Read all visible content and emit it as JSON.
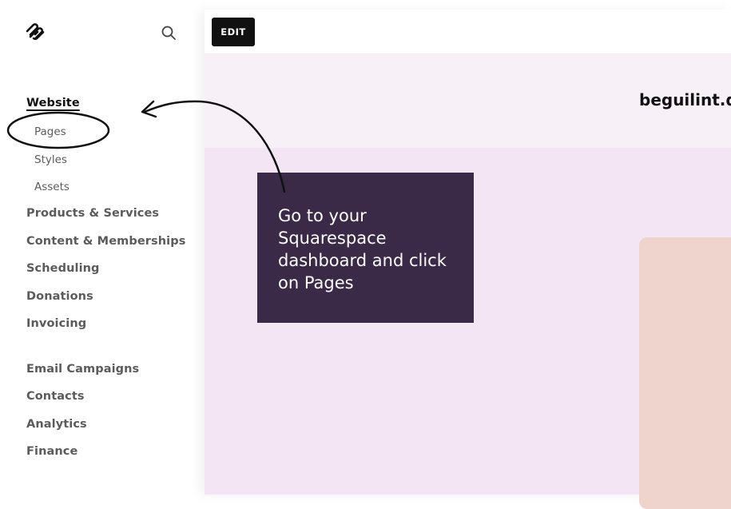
{
  "sidebar": {
    "logo_icon": "squarespace-logo-icon",
    "search_icon": "search-icon",
    "website_label": "Website",
    "sub_items": [
      {
        "label": "Pages"
      },
      {
        "label": "Styles"
      },
      {
        "label": "Assets"
      }
    ],
    "items": [
      {
        "label": "Products & Services"
      },
      {
        "label": "Content & Memberships"
      },
      {
        "label": "Scheduling"
      },
      {
        "label": "Donations"
      },
      {
        "label": "Invoicing"
      },
      {
        "label": "Email Campaigns"
      },
      {
        "label": "Contacts"
      },
      {
        "label": "Analytics"
      },
      {
        "label": "Finance"
      }
    ]
  },
  "preview": {
    "edit_label": "EDIT",
    "site_title": "beguilint.d"
  },
  "callout": {
    "text": "Go to your Squarespace dashboard and click on Pages"
  },
  "colors": {
    "callout_bg": "#3a2a48",
    "preview_bg": "#f3e5f3",
    "card_bg": "#efd4ce"
  }
}
